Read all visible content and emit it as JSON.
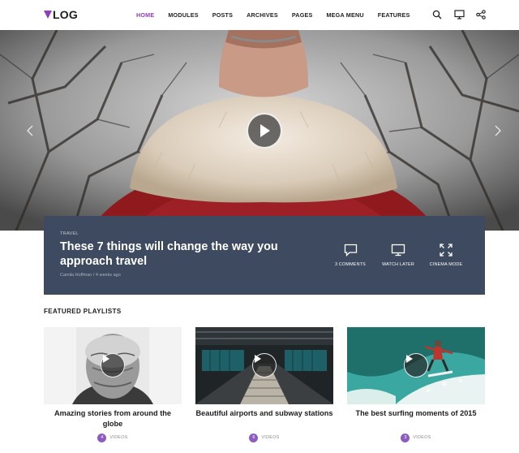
{
  "header": {
    "logo_text": "LOG",
    "nav": [
      "HOME",
      "MODULES",
      "POSTS",
      "ARCHIVES",
      "PAGES",
      "MEGA MENU",
      "FEATURES"
    ],
    "active_nav": "HOME",
    "icons": [
      "search-icon",
      "monitor-icon",
      "share-icon"
    ]
  },
  "hero": {
    "category": "TRAVEL",
    "title": "These 7 things will change the way you approach travel",
    "meta": "Camila Hoffman  /  4 weeks ago",
    "actions": {
      "comments": "3 COMMENTS",
      "watch_later": "WATCH LATER",
      "cinema_mode": "CINEMA MODE"
    }
  },
  "playlists": {
    "section_title": "FEATURED PLAYLISTS",
    "items": [
      {
        "title": "Amazing stories from around the globe",
        "count": "4",
        "label": "VIDEOS"
      },
      {
        "title": "Beautiful airports and subway stations",
        "count": "6",
        "label": "VIDEOS"
      },
      {
        "title": "The best surfing moments of 2015",
        "count": "3",
        "label": "VIDEOS"
      }
    ]
  },
  "colors": {
    "accent": "#8e3fbf",
    "feature_bg": "#3d4a60",
    "badge": "#8e5cc0"
  }
}
